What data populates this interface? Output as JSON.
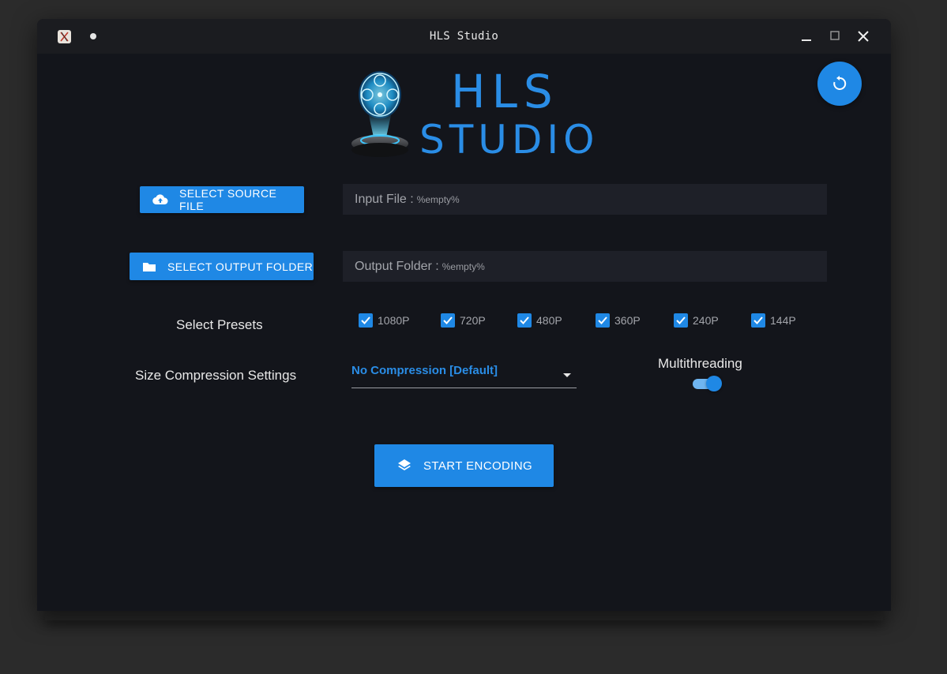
{
  "window": {
    "title": "HLS Studio"
  },
  "logo": {
    "line1": "HLS",
    "line2": "STUDIO"
  },
  "source": {
    "button_label": "SELECT SOURCE FILE",
    "field_label": "Input File :",
    "field_value": "%empty%"
  },
  "output": {
    "button_label": "SELECT OUTPUT FOLDER",
    "field_label": "Output Folder :",
    "field_value": "%empty%"
  },
  "presets": {
    "label": "Select Presets",
    "items": [
      {
        "label": "1080P",
        "checked": true
      },
      {
        "label": "720P",
        "checked": true
      },
      {
        "label": "480P",
        "checked": true
      },
      {
        "label": "360P",
        "checked": true
      },
      {
        "label": "240P",
        "checked": true
      },
      {
        "label": "144P",
        "checked": true
      }
    ]
  },
  "compression": {
    "label": "Size Compression Settings",
    "selected": "No Compression [Default]"
  },
  "multithreading": {
    "label": "Multithreading",
    "enabled": true
  },
  "encode": {
    "button_label": "START ENCODING"
  },
  "icons": {
    "reset": "reset-icon",
    "upload": "cloud-upload-icon",
    "folder": "folder-icon",
    "layers": "layers-icon",
    "check": "check-icon"
  },
  "colors": {
    "accent": "#1f88e5",
    "background": "#13151b",
    "field": "#1e2028"
  }
}
